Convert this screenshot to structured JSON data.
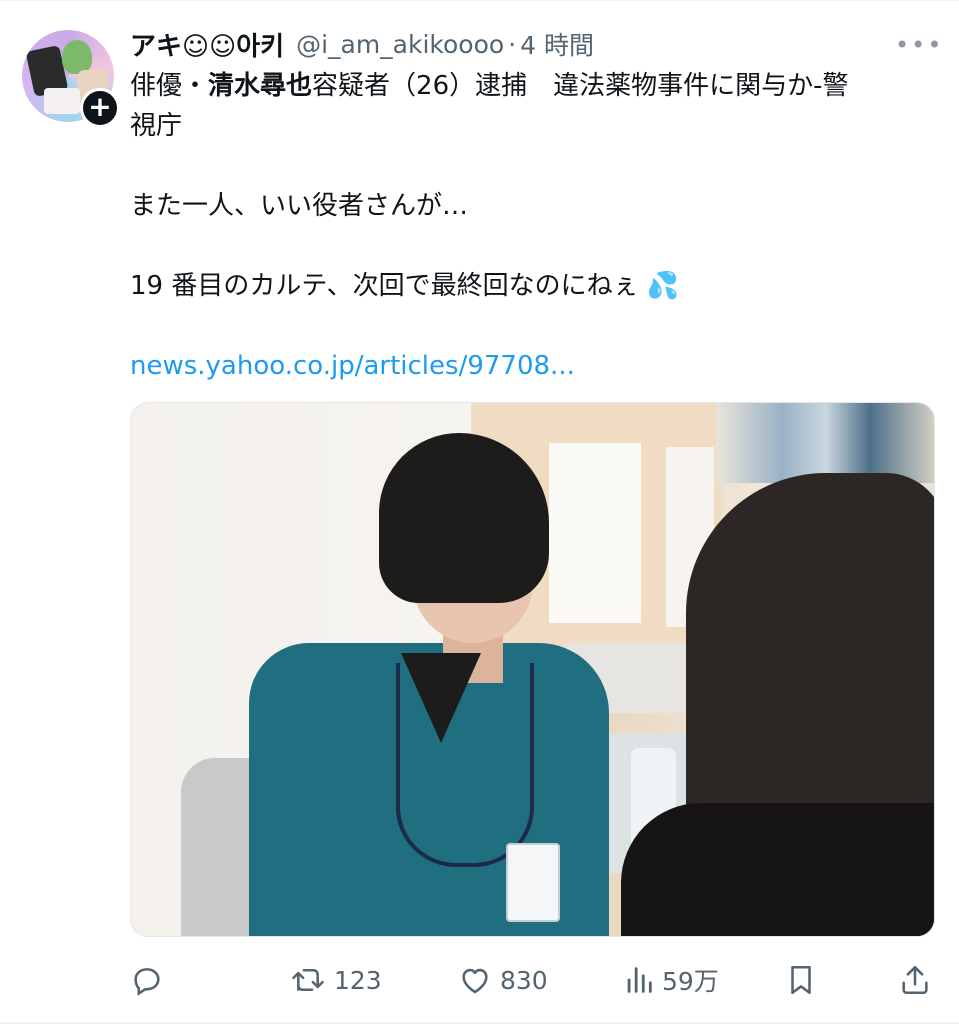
{
  "post": {
    "display_name": "アキ☺☺아키",
    "handle": "@i_am_akikoooo",
    "separator": "·",
    "time": "4 時間",
    "more": "•••",
    "text": {
      "line1_prefix": "俳優・",
      "line1_bold": "清水尋也",
      "line1_suffix": "容疑者（26）逮捕　違法薬物事件に関与か-警",
      "line2": "視庁",
      "line3": "また一人、いい役者さんが…",
      "line4": "19 番目のカルテ、次回で最終回なのにねぇ 💦",
      "link": "news.yahoo.co.jp/articles/97708..."
    }
  },
  "actions": {
    "retweets": "123",
    "likes": "830",
    "views": "59万"
  },
  "colors": {
    "text": "#0f1419",
    "secondary": "#536471",
    "link": "#1d9bf0"
  },
  "icons": {
    "reply": "reply-icon",
    "retweet": "retweet-icon",
    "like": "heart-icon",
    "views": "analytics-icon",
    "bookmark": "bookmark-icon",
    "share": "share-icon",
    "more": "more-icon",
    "follow": "plus-icon"
  }
}
